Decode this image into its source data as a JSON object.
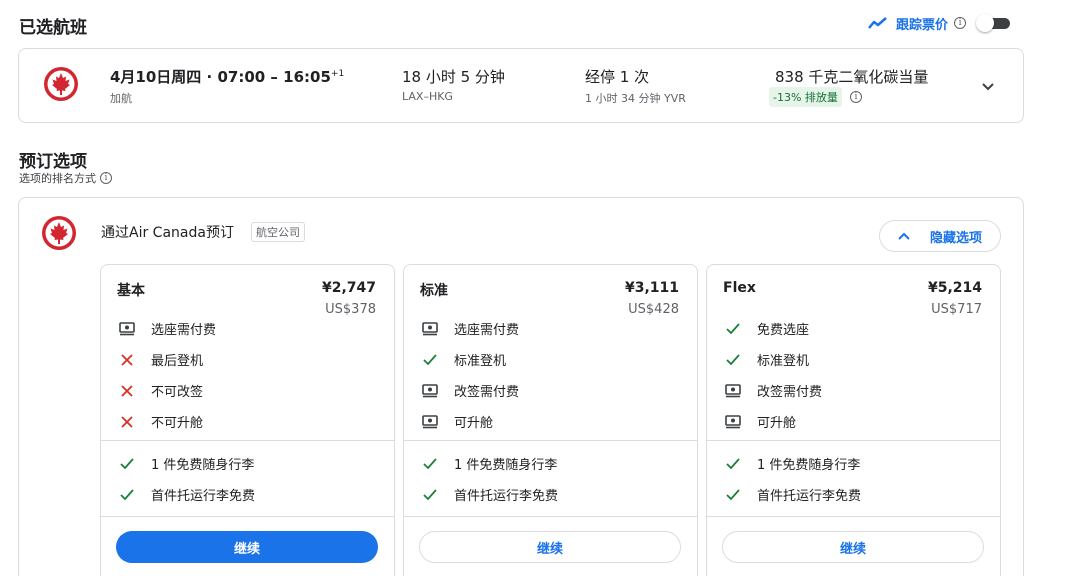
{
  "selected": {
    "title": "已选航班",
    "track_label": "跟踪票价",
    "track_on": false
  },
  "flight": {
    "time": "4月10日周四 · 07:00 – 16:05",
    "day_offset": "+1",
    "airline": "加航",
    "duration": "18 小时 5 分钟",
    "route": "LAX–HKG",
    "stops": "经停 1 次",
    "layover": "1 小时 34 分钟 YVR",
    "co2": "838 千克二氧化碳当量",
    "emissions": "-13% 排放量"
  },
  "booking": {
    "title": "预订选项",
    "subtitle": "选项的排名方式",
    "provider_title": "通过Air Canada预订",
    "provider_tag": "航空公司",
    "hide_label": "隐藏选项"
  },
  "fares": [
    {
      "name": "基本",
      "price": "¥2,747",
      "usd": "US$378",
      "features": [
        {
          "icon": "money",
          "text": "选座需付费"
        },
        {
          "icon": "cross",
          "text": "最后登机"
        },
        {
          "icon": "cross",
          "text": "不可改签"
        },
        {
          "icon": "cross",
          "text": "不可升舱"
        }
      ],
      "baggage": [
        {
          "icon": "check",
          "text": "1 件免费随身行李"
        },
        {
          "icon": "check",
          "text": "首件托运行李免费"
        }
      ],
      "cta": "继续",
      "primary": true
    },
    {
      "name": "标准",
      "price": "¥3,111",
      "usd": "US$428",
      "features": [
        {
          "icon": "money",
          "text": "选座需付费"
        },
        {
          "icon": "check",
          "text": "标准登机"
        },
        {
          "icon": "money",
          "text": "改签需付费"
        },
        {
          "icon": "money",
          "text": "可升舱"
        }
      ],
      "baggage": [
        {
          "icon": "check",
          "text": "1 件免费随身行李"
        },
        {
          "icon": "check",
          "text": "首件托运行李免费"
        }
      ],
      "cta": "继续",
      "primary": false
    },
    {
      "name": "Flex",
      "price": "¥5,214",
      "usd": "US$717",
      "features": [
        {
          "icon": "check",
          "text": "免费选座"
        },
        {
          "icon": "check",
          "text": "标准登机"
        },
        {
          "icon": "money",
          "text": "改签需付费"
        },
        {
          "icon": "money",
          "text": "可升舱"
        }
      ],
      "baggage": [
        {
          "icon": "check",
          "text": "1 件免费随身行李"
        },
        {
          "icon": "check",
          "text": "首件托运行李免费"
        }
      ],
      "cta": "继续",
      "primary": false
    }
  ],
  "colors": {
    "accent": "#1a73e8",
    "check": "#188038",
    "cross": "#d93025",
    "emissions_bg": "#e6f4ea",
    "emissions_text": "#137333"
  }
}
